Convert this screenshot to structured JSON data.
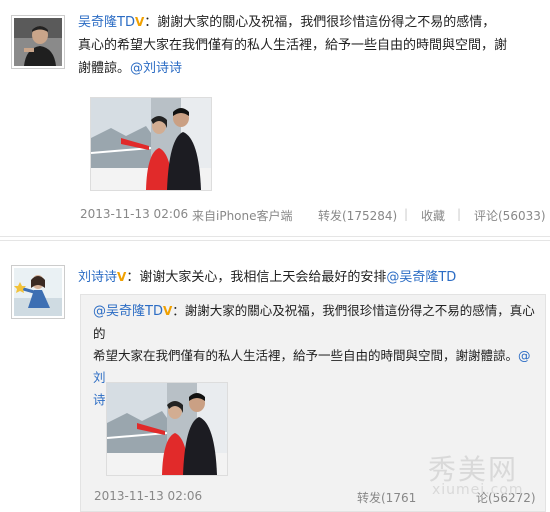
{
  "post1": {
    "author": "吴奇隆TD",
    "verified_mark": "V",
    "text_lines": [
      "：謝謝大家的關心及祝福，我們很珍惜這份得之不易的感情，",
      "真心的希望大家在我們僅有的私人生活裡，給予一些自由的時間與空間，謝",
      "謝體諒。"
    ],
    "mention": "@刘诗诗",
    "timestamp": "2013-11-13 02:06",
    "source": "来自iPhone客户端",
    "repost": "转发(175284)",
    "favorite": "收藏",
    "comment": "评论(56033)"
  },
  "post2": {
    "author": "刘诗诗",
    "verified_mark": "V",
    "text": "：谢谢大家关心，我相信上天会给最好的安排",
    "mention": "@吴奇隆TD",
    "quoted": {
      "author": "@吴奇隆TD",
      "verified_mark": "V",
      "text_lines": [
        "：謝謝大家的關心及祝福，我們很珍惜這份得之不易的感情，真心的",
        "希望大家在我們僅有的私人生活裡，給予一些自由的時間與空間，謝謝體諒。"
      ],
      "mention": "@刘",
      "mention_wrap": "诗诗",
      "timestamp": "2013-11-13 02:06",
      "repost": "转发(1761",
      "comment": "论(56272)"
    }
  },
  "watermark": {
    "main": "秀美网",
    "sub": "xiumei.com"
  },
  "colors": {
    "link": "#2b6cc4",
    "verified": "#f0a000",
    "meta": "#888888"
  }
}
